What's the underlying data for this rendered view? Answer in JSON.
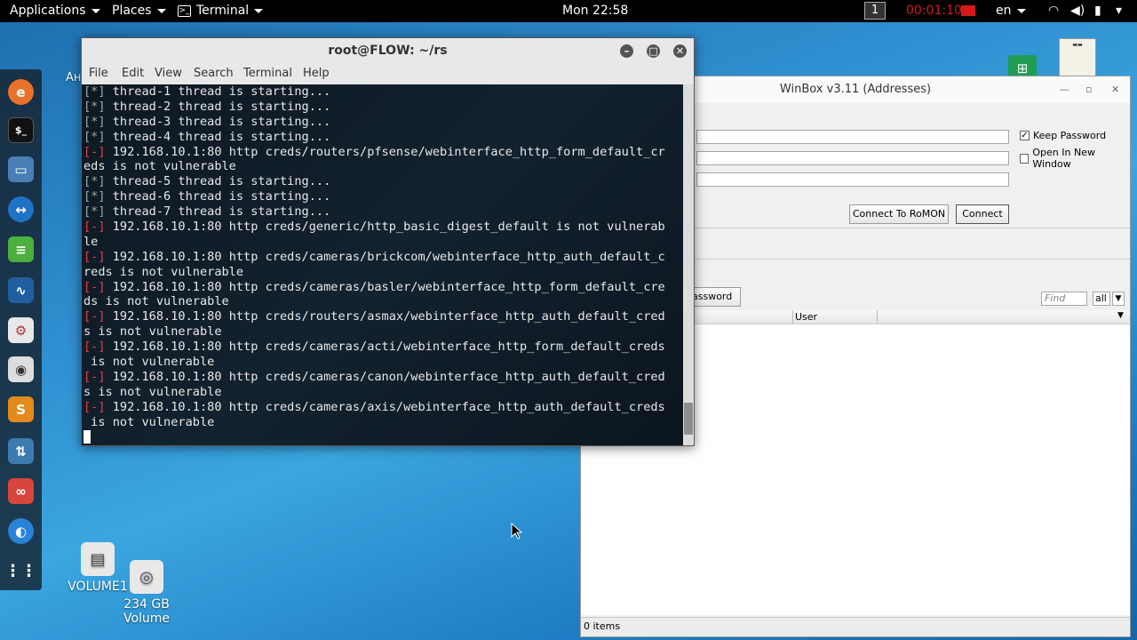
{
  "topbar": {
    "applications": "Applications",
    "places": "Places",
    "terminal": "Terminal",
    "clock": "Mon 22:58",
    "workspace": "1",
    "rec_time": "00:01:10",
    "lang": "en"
  },
  "dock": [
    "firefox-icon",
    "terminal-icon",
    "files-icon",
    "teamviewer-icon",
    "notes-icon",
    "wireshark-icon",
    "settings-icon",
    "audio-icon",
    "sublime-icon",
    "upload-icon",
    "glasses-icon",
    "network-icon",
    "apps-grid-icon"
  ],
  "desktop": {
    "volume1": "VOLUME1",
    "disk_size": "234 GB",
    "disk_label": "Volume",
    "partial_label": "Ан"
  },
  "winbox": {
    "title": "WinBox v3.11 (Addresses)",
    "keep_password": "Keep Password",
    "open_new_window": "Open In New Window",
    "connect_romon": "Connect To RoMON",
    "connect": "Connect",
    "password_col": "assword",
    "find_placeholder": "Find",
    "filter_all": "all",
    "col_user": "User",
    "status": "0 items"
  },
  "terminal": {
    "title": "root@FLOW: ~/rs",
    "menu": [
      "File",
      "Edit",
      "View",
      "Search",
      "Terminal",
      "Help"
    ],
    "lines": [
      {
        "m": "[*]",
        "t": " thread-1 thread is starting...",
        "e": false
      },
      {
        "m": "[*]",
        "t": " thread-2 thread is starting...",
        "e": false
      },
      {
        "m": "[*]",
        "t": " thread-3 thread is starting...",
        "e": false
      },
      {
        "m": "[*]",
        "t": " thread-4 thread is starting...",
        "e": false
      },
      {
        "m": "[-]",
        "t": " 192.168.10.1:80 http creds/routers/pfsense/webinterface_http_form_default_cr",
        "e": true
      },
      {
        "m": "",
        "t": "eds is not vulnerable",
        "e": false
      },
      {
        "m": "[*]",
        "t": " thread-5 thread is starting...",
        "e": false
      },
      {
        "m": "[*]",
        "t": " thread-6 thread is starting...",
        "e": false
      },
      {
        "m": "[*]",
        "t": " thread-7 thread is starting...",
        "e": false
      },
      {
        "m": "[-]",
        "t": " 192.168.10.1:80 http creds/generic/http_basic_digest_default is not vulnerab",
        "e": true
      },
      {
        "m": "",
        "t": "le",
        "e": false
      },
      {
        "m": "[-]",
        "t": " 192.168.10.1:80 http creds/cameras/brickcom/webinterface_http_auth_default_c",
        "e": true
      },
      {
        "m": "",
        "t": "reds is not vulnerable",
        "e": false
      },
      {
        "m": "[-]",
        "t": " 192.168.10.1:80 http creds/cameras/basler/webinterface_http_form_default_cre",
        "e": true
      },
      {
        "m": "",
        "t": "ds is not vulnerable",
        "e": false
      },
      {
        "m": "[-]",
        "t": " 192.168.10.1:80 http creds/routers/asmax/webinterface_http_auth_default_cred",
        "e": true
      },
      {
        "m": "",
        "t": "s is not vulnerable",
        "e": false
      },
      {
        "m": "[-]",
        "t": " 192.168.10.1:80 http creds/cameras/acti/webinterface_http_form_default_creds",
        "e": true
      },
      {
        "m": "",
        "t": " is not vulnerable",
        "e": false
      },
      {
        "m": "[-]",
        "t": " 192.168.10.1:80 http creds/cameras/canon/webinterface_http_auth_default_cred",
        "e": true
      },
      {
        "m": "",
        "t": "s is not vulnerable",
        "e": false
      },
      {
        "m": "[-]",
        "t": " 192.168.10.1:80 http creds/cameras/axis/webinterface_http_auth_default_creds",
        "e": true
      },
      {
        "m": "",
        "t": " is not vulnerable",
        "e": false
      }
    ]
  }
}
